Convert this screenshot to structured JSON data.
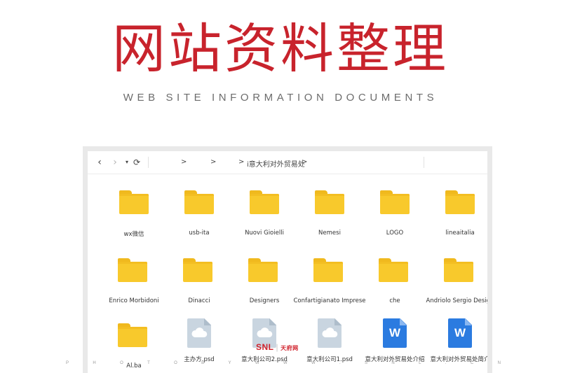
{
  "hero": {
    "title": "网站资料整理",
    "subtitle": "Web Site Information Documents"
  },
  "toolbar": {
    "back_icon": "‹",
    "forward_icon": "›",
    "dropdown_icon": "▾",
    "refresh_icon": "⟳",
    "crumbs": [
      ">",
      ">",
      ">",
      "i意大利对外贸易处",
      ">"
    ]
  },
  "items": [
    {
      "type": "folder",
      "label": "wx微信"
    },
    {
      "type": "folder",
      "label": "usb-ita"
    },
    {
      "type": "folder",
      "label": "Nuovi Gioielli"
    },
    {
      "type": "folder",
      "label": "Nemesi"
    },
    {
      "type": "folder",
      "label": "LOGO"
    },
    {
      "type": "folder",
      "label": "lineaitalia"
    },
    {
      "type": "folder",
      "label": "Enrico Morbidoni"
    },
    {
      "type": "folder",
      "label": "Dinacci"
    },
    {
      "type": "folder",
      "label": "Designers"
    },
    {
      "type": "folder",
      "label": "Confartigianato Imprese"
    },
    {
      "type": "folder",
      "label": "che"
    },
    {
      "type": "folder",
      "label": "Andriolo Sergio Design"
    },
    {
      "type": "folder",
      "label": "Al.ba"
    },
    {
      "type": "psd",
      "label": "主办方.psd"
    },
    {
      "type": "psd",
      "label": "意大利公司2.psd"
    },
    {
      "type": "psd",
      "label": "意大利公司1.psd"
    },
    {
      "type": "doc",
      "label": "意大利对外贸易处介绍"
    },
    {
      "type": "doc",
      "label": "意大利对外贸易处简介"
    }
  ],
  "doc_letter": "W",
  "watermark": {
    "logo": "SNL",
    "separator": "|",
    "logo_cn": "天府网",
    "strip": [
      "P",
      "H",
      "O",
      "T",
      "O",
      "B",
      "Y",
      "W",
      "W",
      "W",
      ".",
      "S",
      "N",
      "L",
      ".",
      "C",
      "N"
    ]
  },
  "colors": {
    "title_red": "#c8232c",
    "folder_yellow": "#f8c92c",
    "doc_blue": "#2b7be0",
    "psd_gray": "#c9d5e0"
  }
}
